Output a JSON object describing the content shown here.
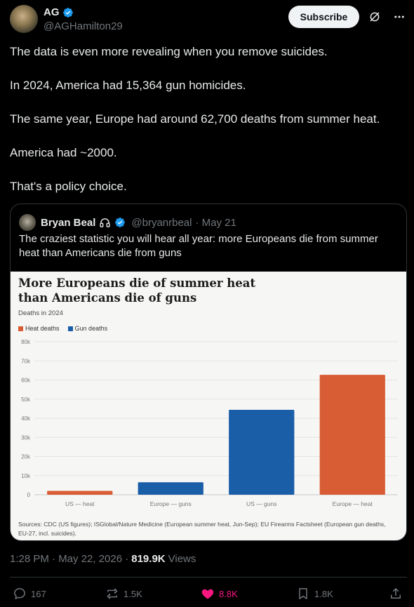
{
  "author": {
    "name": "AG",
    "handle": "@AGHamilton29"
  },
  "subscribe_label": "Subscribe",
  "post_lines": [
    "The data is even more revealing when you remove suicides.",
    "In 2024, America had 15,364 gun homicides.",
    "The same year, Europe had around 62,700 deaths from summer heat.",
    "America had ~2000.",
    "That's a policy choice."
  ],
  "quote": {
    "name": "Bryan Beal",
    "handle": "@bryanrbeal",
    "date": "· May 21",
    "text": "The craziest statistic you will hear all year: more Europeans die from summer heat than Americans die from guns"
  },
  "chart_data": {
    "type": "bar",
    "title": "More Europeans die of summer heat than Americans die of guns",
    "subtitle": "Deaths in 2024",
    "legend": [
      {
        "name": "Heat deaths",
        "color": "#d95d34"
      },
      {
        "name": "Gun deaths",
        "color": "#1a5ea8"
      }
    ],
    "categories": [
      "US — heat",
      "Europe — guns",
      "US — guns",
      "Europe — heat"
    ],
    "values": [
      2000,
      6500,
      44400,
      62700
    ],
    "series_of_bar": [
      "Heat deaths",
      "Gun deaths",
      "Gun deaths",
      "Heat deaths"
    ],
    "y_ticks": [
      "0",
      "10k",
      "20k",
      "30k",
      "40k",
      "50k",
      "60k",
      "70k",
      "80k"
    ],
    "ylim": [
      0,
      80000
    ],
    "grid": true,
    "sources": "Sources: CDC (US figures); ISGlobal/Nature Medicine (European summer heat, Jun-Sep); EU Firearms Factsheet (European gun deaths, EU-27, incl. suicides)."
  },
  "meta": {
    "time": "1:28 PM · May 22, 2026 ·",
    "views_count": "819.9K",
    "views_label": "Views"
  },
  "actions": {
    "replies": "167",
    "reposts": "1.5K",
    "likes": "8.8K",
    "bookmarks": "1.8K"
  },
  "colors": {
    "accent_blue": "#1d9bf0",
    "like_pink": "#f91880",
    "heat": "#d95d34",
    "gun": "#1a5ea8"
  }
}
